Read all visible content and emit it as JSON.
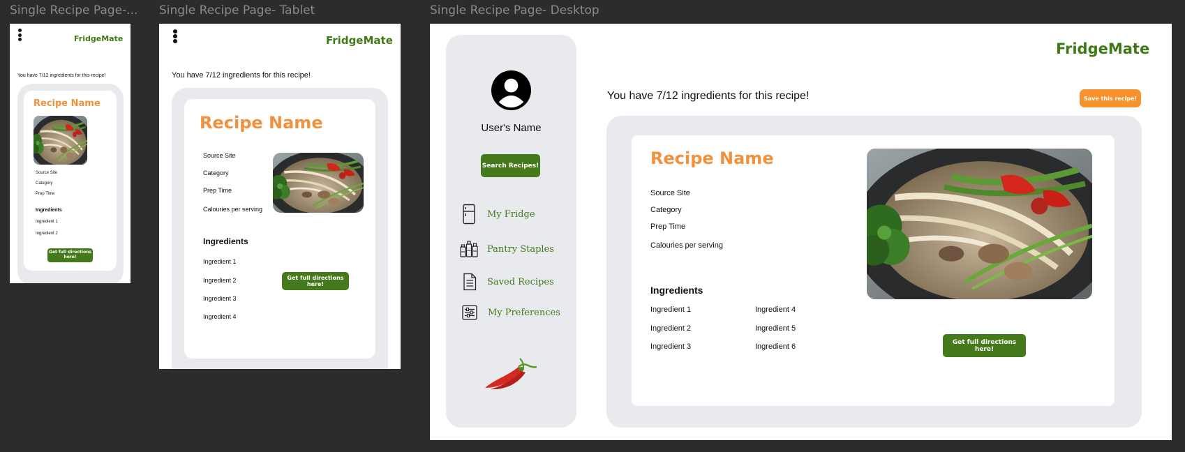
{
  "frames": {
    "mobile_title": "Single Recipe Page-...",
    "tablet_title": "Single Recipe Page- Tablet",
    "desktop_title": "Single Recipe Page- Desktop"
  },
  "app": {
    "logo": "FridgeMate"
  },
  "recipe": {
    "have_text": "You have 7/12 ingredients for this recipe!",
    "name": "Recipe Name",
    "source_site": "Source Site",
    "category": "Category",
    "prep_time": "Prep Time",
    "calories": "Calouries per serving",
    "ingredients_heading": "Ingredients",
    "ingredients": [
      "Ingredient 1",
      "Ingredient 2",
      "Ingredient 3",
      "Ingredient 4",
      "Ingredient 5",
      "Ingredient 6"
    ],
    "directions_button": "Get full directions here!",
    "save_button": "Save this recipe!"
  },
  "sidebar": {
    "user_name": "User's Name",
    "search_button": "Search Recipes!",
    "items": [
      {
        "label": "My Fridge",
        "icon": "fridge-icon"
      },
      {
        "label": "Pantry Staples",
        "icon": "pantry-jars-icon"
      },
      {
        "label": "Saved Recipes",
        "icon": "document-icon"
      },
      {
        "label": "My Preferences",
        "icon": "sliders-icon"
      }
    ],
    "decor_icon": "chili-pepper-icon"
  },
  "colors": {
    "brand_green": "#447a1b",
    "accent_orange": "#f2913d",
    "panel_grey": "#e9eaee"
  }
}
